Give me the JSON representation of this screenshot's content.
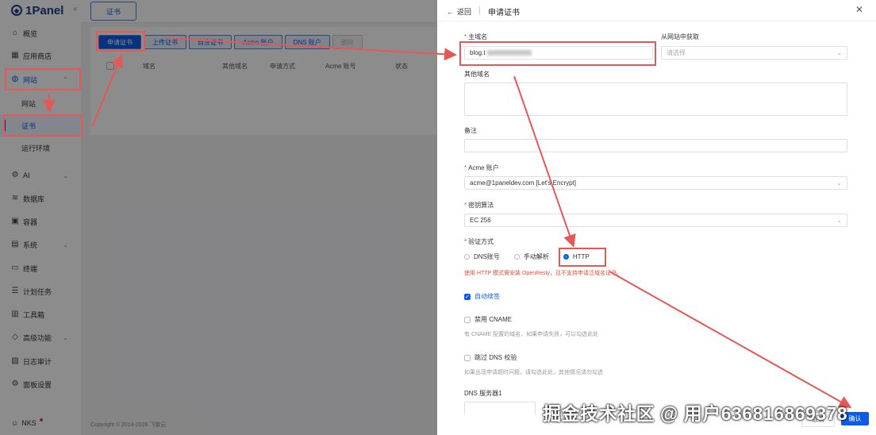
{
  "sidebar": {
    "logo": "1Panel",
    "items": [
      {
        "label": "概览",
        "icon": "home-icon"
      },
      {
        "label": "应用商店",
        "icon": "grid-icon"
      },
      {
        "label": "网站",
        "icon": "globe-icon"
      },
      {
        "label": "网站"
      },
      {
        "label": "证书"
      },
      {
        "label": "运行环境"
      },
      {
        "label": "AI",
        "icon": "robot-icon"
      },
      {
        "label": "数据库",
        "icon": "database-icon"
      },
      {
        "label": "容器",
        "icon": "container-icon"
      },
      {
        "label": "系统",
        "icon": "system-icon"
      },
      {
        "label": "终端",
        "icon": "terminal-icon"
      },
      {
        "label": "计划任务",
        "icon": "cron-icon"
      },
      {
        "label": "工具箱",
        "icon": "toolbox-icon"
      },
      {
        "label": "高级功能",
        "icon": "diamond-icon"
      },
      {
        "label": "日志审计",
        "icon": "log-icon"
      },
      {
        "label": "面板设置",
        "icon": "settings-icon"
      }
    ],
    "user": "NKS"
  },
  "main": {
    "breadcrumb": "证书",
    "toolbar": [
      "申请证书",
      "上传证书",
      "自签证书",
      "Acme 账户",
      "DNS 账户",
      "删除"
    ],
    "columns": [
      "域名",
      "其他域名",
      "申请方式",
      "Acme 账号",
      "状态"
    ],
    "footer": "Copyright © 2014-2026 飞致云"
  },
  "drawer": {
    "back": "返回",
    "title": "申请证书",
    "primary_domain_label": "主域名",
    "primary_domain_value": "blog.t",
    "from_site_label": "从网站中获取",
    "from_site_placeholder": "请选择",
    "other_domains_label": "其他域名",
    "remark_label": "备注",
    "acme_label": "Acme 账户",
    "acme_value": "acme@1paneldev.com [Let's Encrypt]",
    "key_algo_label": "密钥算法",
    "key_algo_value": "EC 256",
    "verify_label": "验证方式",
    "verify_options": [
      "DNS账号",
      "手动解析",
      "HTTP"
    ],
    "verify_warning": "使用 HTTP 模式需安装 OpenResty，且不支持申请泛域名证书。",
    "auto_renew": "自动续签",
    "disable_cname": "禁用 CNAME",
    "disable_cname_hint": "有 CNAME 配置的域名，如果申请失败，可以勾选此处",
    "skip_dns": "跳过 DNS 校验",
    "skip_dns_hint": "如果出现申请超时问题，请勾选此处，其他情况请勿勾选",
    "dns_server_label": "DNS 服务器1",
    "cancel": "取消",
    "confirm": "确认"
  },
  "watermark": "掘金技术社区 @ 用户636816869378",
  "colors": {
    "primary": "#0c5be7",
    "annotation": "#e45858",
    "warning": "#e74c3c"
  }
}
